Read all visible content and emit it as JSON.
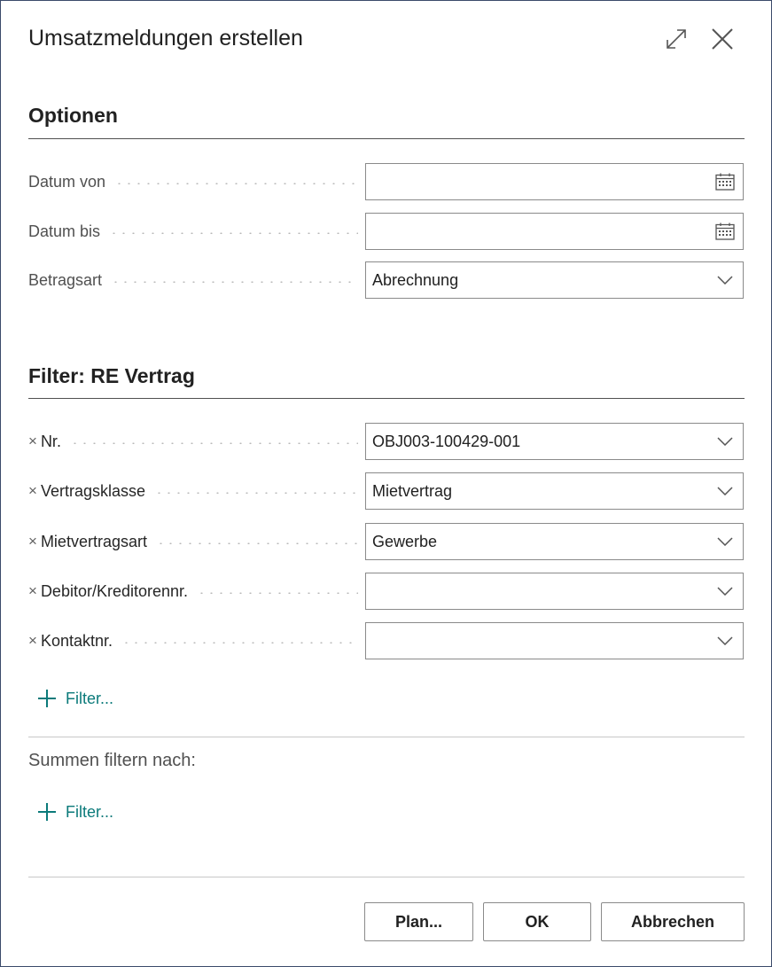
{
  "dialog": {
    "title": "Umsatzmeldungen erstellen",
    "icons": [
      "expand-icon",
      "close-icon"
    ]
  },
  "options": {
    "title": "Optionen",
    "fields": [
      {
        "label": "Datum von",
        "value": "",
        "trailing": "calendar-icon"
      },
      {
        "label": "Datum bis",
        "value": "",
        "trailing": "calendar-icon"
      },
      {
        "label": "Betragsart",
        "value": "Abrechnung",
        "trailing": "chevron-down-icon"
      }
    ]
  },
  "filter": {
    "title": "Filter: RE Vertrag",
    "fields": [
      {
        "label": "Nr.",
        "value": "OBJ003-100429-001"
      },
      {
        "label": "Vertragsklasse",
        "value": "Mietvertrag"
      },
      {
        "label": "Mietvertragsart",
        "value": "Gewerbe"
      },
      {
        "label": "Debitor/Kreditorennr.",
        "value": ""
      },
      {
        "label": "Kontaktnr.",
        "value": ""
      }
    ],
    "add_filter_label": "Filter...",
    "remove_glyph": "×"
  },
  "totals": {
    "label": "Summen filtern nach:",
    "add_filter_label": "Filter..."
  },
  "footer": {
    "plan_label": "Plan...",
    "ok_label": "OK",
    "cancel_label": "Abbrechen"
  },
  "colors": {
    "accent": "#0b7a7a",
    "border": "#8a8a8a",
    "frame": "#3b4a6b"
  }
}
